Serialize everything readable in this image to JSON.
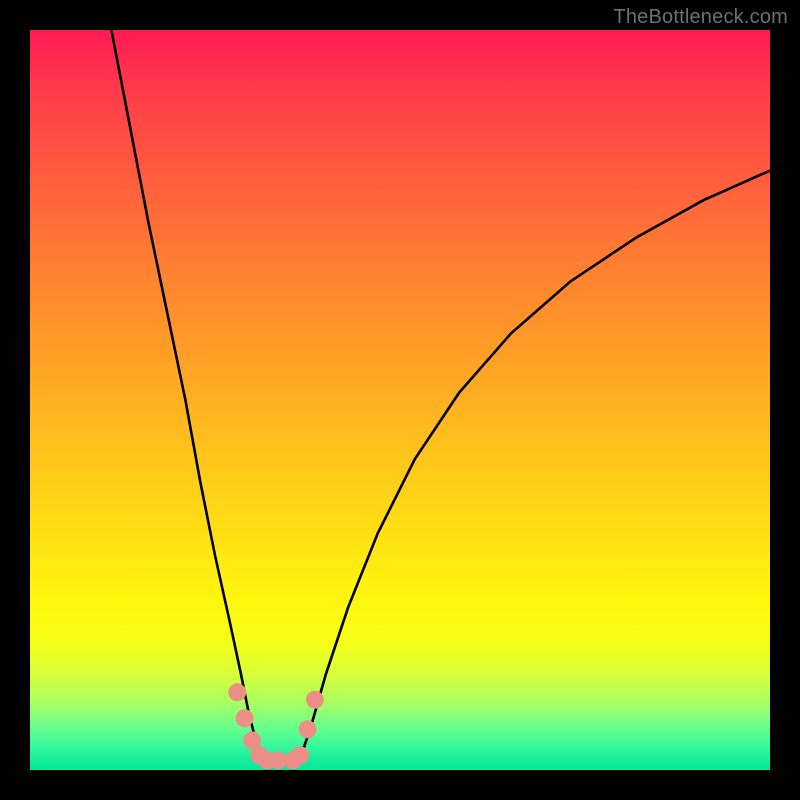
{
  "watermark": "TheBottleneck.com",
  "chart_data": {
    "type": "line",
    "title": "",
    "xlabel": "",
    "ylabel": "",
    "xlim": [
      0,
      100
    ],
    "ylim": [
      0,
      100
    ],
    "grid": false,
    "legend": false,
    "series": [
      {
        "name": "left-branch",
        "x": [
          11,
          13.5,
          16,
          18.5,
          21,
          23,
          25,
          27,
          28.5,
          29.5,
          30.5,
          31.5
        ],
        "y": [
          100,
          87,
          74,
          62,
          50,
          39,
          29,
          20,
          13,
          8,
          4,
          1.5
        ]
      },
      {
        "name": "right-branch",
        "x": [
          36.5,
          38,
          40,
          43,
          47,
          52,
          58,
          65,
          73,
          82,
          91,
          100
        ],
        "y": [
          1.5,
          6,
          13,
          22,
          32,
          42,
          51,
          59,
          66,
          72,
          77,
          81
        ]
      }
    ],
    "valley_floor": {
      "x_start": 31.5,
      "x_end": 36.5,
      "y": 1.5
    },
    "markers": {
      "name": "valley-markers",
      "color": "#ec8f86",
      "points": [
        {
          "x": 28.0,
          "y": 10.5
        },
        {
          "x": 29.0,
          "y": 7.0
        },
        {
          "x": 30.0,
          "y": 4.0
        },
        {
          "x": 31.0,
          "y": 2.0
        },
        {
          "x": 32.0,
          "y": 1.3
        },
        {
          "x": 33.5,
          "y": 1.3
        },
        {
          "x": 35.5,
          "y": 1.3
        },
        {
          "x": 36.5,
          "y": 2.0
        },
        {
          "x": 37.5,
          "y": 5.5
        },
        {
          "x": 38.5,
          "y": 9.5
        }
      ]
    },
    "background_gradient": {
      "top": "#ff1a54",
      "mid": "#ffd317",
      "bottom": "#00e89a"
    }
  }
}
